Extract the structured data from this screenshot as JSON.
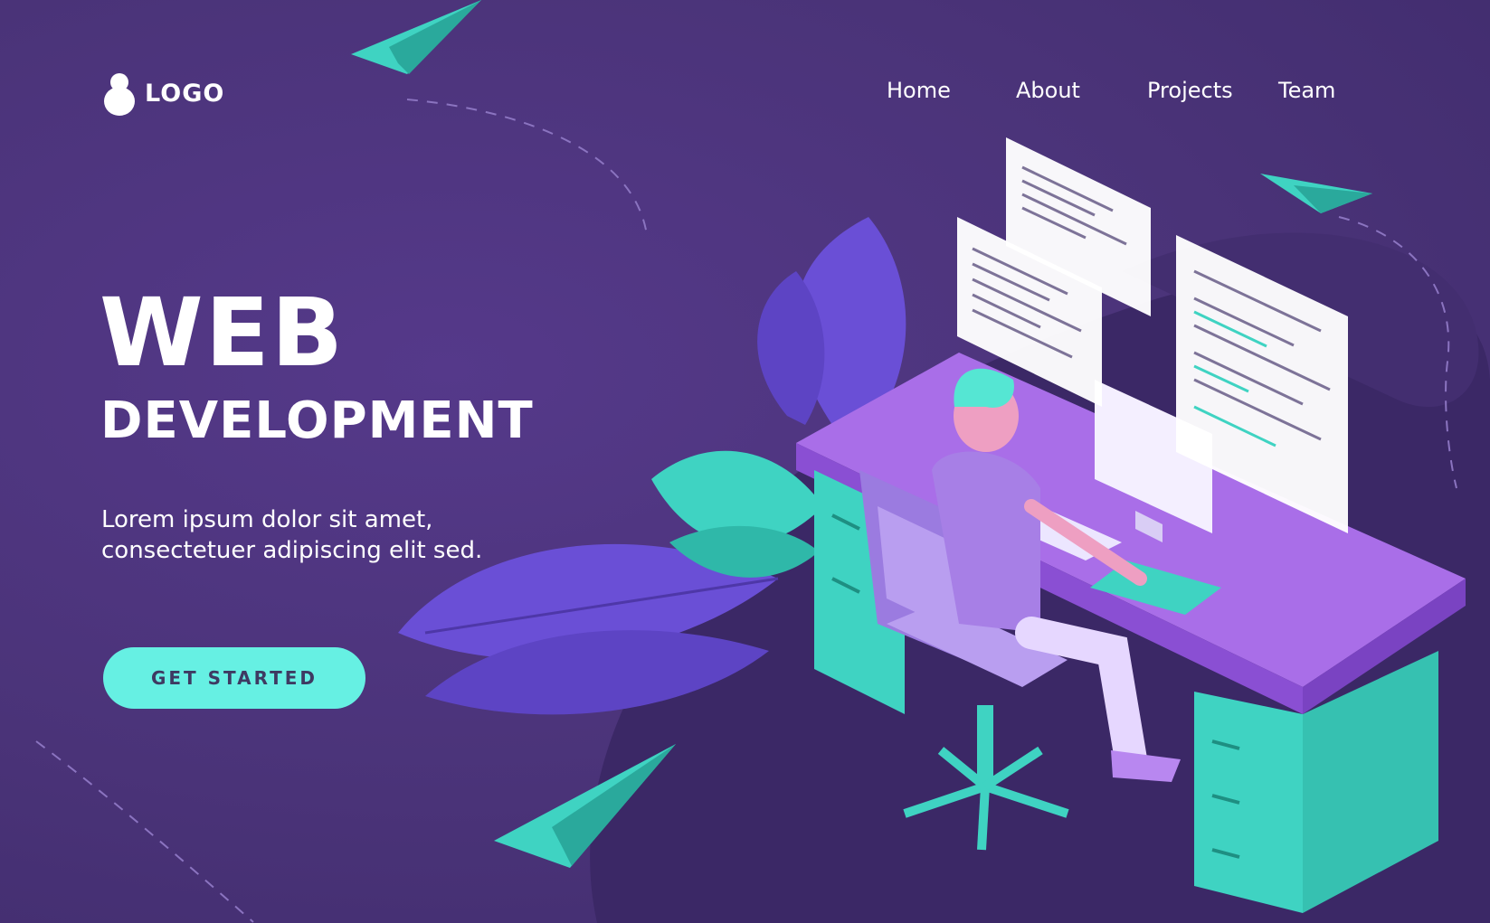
{
  "header": {
    "logo_text": "LOGO",
    "nav": [
      {
        "label": "Home"
      },
      {
        "label": "About"
      },
      {
        "label": "Projects"
      },
      {
        "label": "Team"
      }
    ]
  },
  "hero": {
    "title_line1": "WEB",
    "title_line2": "DEVELOPMENT",
    "subtitle_line1": "Lorem ipsum dolor sit amet,",
    "subtitle_line2": "consectetuer adipiscing elit sed.",
    "cta_label": "GET STARTED"
  },
  "colors": {
    "background": "#4a3478",
    "accent": "#66f0e3",
    "desk": "#a96ee8",
    "leaf_purple": "#6a4fd6",
    "text": "#ffffff"
  },
  "icons": [
    "logo-mark-icon",
    "paper-plane-icon",
    "leaf-icon"
  ]
}
